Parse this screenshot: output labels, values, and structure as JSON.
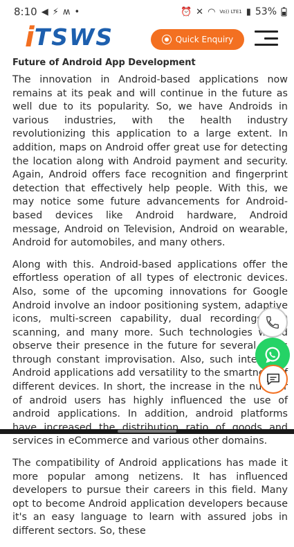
{
  "status_bar": {
    "time": "8:10",
    "left_icons": [
      "send-icon",
      "thunder-icon",
      "m-icon",
      "dot-icon"
    ],
    "right_icons": [
      "alarm-icon",
      "mute-icon",
      "wifi-icon",
      "signal-icon"
    ],
    "network_label": "Vo)) LTE1",
    "battery": "53%"
  },
  "header": {
    "logo_text_i": "i",
    "logo_text_rest": "TSWS",
    "quick_enquiry_label": "Quick Enquiry"
  },
  "article": {
    "heading": "Future of Android App Development",
    "paragraphs": [
      "The innovation in Android-based applications now remains at its peak and will continue in the future as well due to its popularity. So, we have Androids in various industries, with the health industry revolutionizing this application to a large extent. In addition, maps on Android offer great use for detecting the location along with Android payment and security. Again, Android offers face recognition and fingerprint detection that effectively help people. With this, we may notice some future advancements for Android-based devices like Android hardware, Android message, Android on Television, Android on wearable, Android for automobiles, and many others.",
      "Along with this. Android-based applications offer the effortless operation of all types of electronic devices. Also, some of the upcoming innovations for Google Android involve an indoor positioning system, adaptive icons, multi-screen capability, dual recordings, 3D scanning, and many more. Such technologies would observe their presence in the future for several years through constant improvisation. Also, such intelligent Android applications add versatility to the smartness of different devices. In short, the increase in the number of android users has highly influenced the use of android applications. In addition, android platforms have increased the distribution ratio of goods and services in eCommerce and various other domains.",
      "The compatibility of Android applications has made it more popular among netizens. It has influenced developers to pursue their careers in this field. Many opt to become Android application developers because it's an easy language to learn with assured jobs in different sectors. So, these"
    ]
  },
  "floating_actions": [
    "phone-icon",
    "whatsapp-icon",
    "chat-icon"
  ],
  "colors": {
    "brand_orange": "#f37021",
    "brand_blue": "#1d5fae",
    "whatsapp_green": "#25d366"
  }
}
